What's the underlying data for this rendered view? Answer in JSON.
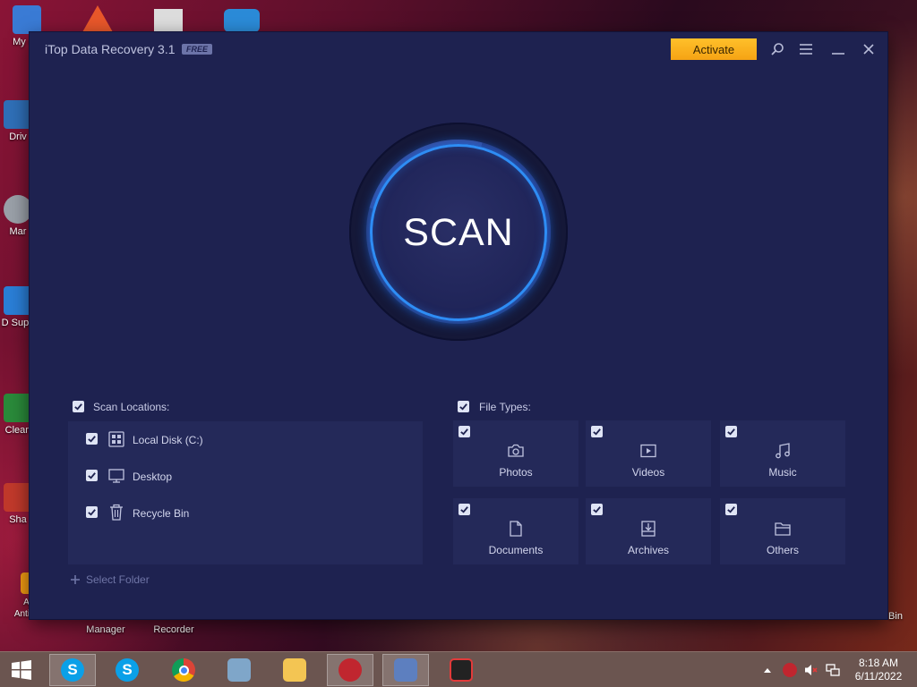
{
  "desktop": {
    "icons": [
      {
        "label": "My Co",
        "color": "#3a7bd5"
      },
      {
        "label": "Driv",
        "color": "#2f6fb7"
      },
      {
        "label": "Mar",
        "color": "#9aa"
      },
      {
        "label": "D Supp",
        "color": "#2a7ed6"
      },
      {
        "label": "Clean",
        "color": "#2a8a3a"
      },
      {
        "label": "Sha",
        "color": "#c0392b"
      },
      {
        "label": "Ada Antivirus",
        "color": "#f39c12"
      },
      {
        "label": "Manager",
        "color": "#aaa"
      },
      {
        "label": "Recorder",
        "color": "#aaa"
      },
      {
        "label": "Bin",
        "color": "#aaa"
      }
    ]
  },
  "app": {
    "title": "iTop Data Recovery 3.1",
    "badge": "FREE",
    "activate_label": "Activate",
    "scan_label": "SCAN",
    "scan_locations": {
      "header": "Scan Locations:",
      "items": [
        {
          "label": "Local Disk (C:)",
          "icon": "hard-disk-icon",
          "checked": true
        },
        {
          "label": "Desktop",
          "icon": "monitor-icon",
          "checked": true
        },
        {
          "label": "Recycle Bin",
          "icon": "trash-icon",
          "checked": true
        }
      ],
      "select_folder": "Select Folder"
    },
    "file_types": {
      "header": "File Types:",
      "items": [
        {
          "label": "Photos",
          "icon": "camera-icon",
          "checked": true
        },
        {
          "label": "Videos",
          "icon": "video-icon",
          "checked": true
        },
        {
          "label": "Music",
          "icon": "music-note-icon",
          "checked": true
        },
        {
          "label": "Documents",
          "icon": "document-icon",
          "checked": true
        },
        {
          "label": "Archives",
          "icon": "archive-icon",
          "checked": true
        },
        {
          "label": "Others",
          "icon": "folder-icon",
          "checked": true
        }
      ]
    },
    "colors": {
      "accent": "#2e8df5",
      "activate": "#f5a314",
      "window": "#1e2250",
      "panel": "#242959"
    }
  },
  "taskbar": {
    "apps": [
      {
        "name": "windows-start-icon"
      },
      {
        "name": "skype-icon"
      },
      {
        "name": "skype-icon"
      },
      {
        "name": "chrome-icon"
      },
      {
        "name": "screenshot-tool-icon"
      },
      {
        "name": "file-explorer-icon"
      },
      {
        "name": "itop-icon"
      },
      {
        "name": "photo-viewer-icon"
      },
      {
        "name": "screen-recorder-icon"
      }
    ],
    "time": "8:18 AM",
    "date": "6/11/2022"
  }
}
